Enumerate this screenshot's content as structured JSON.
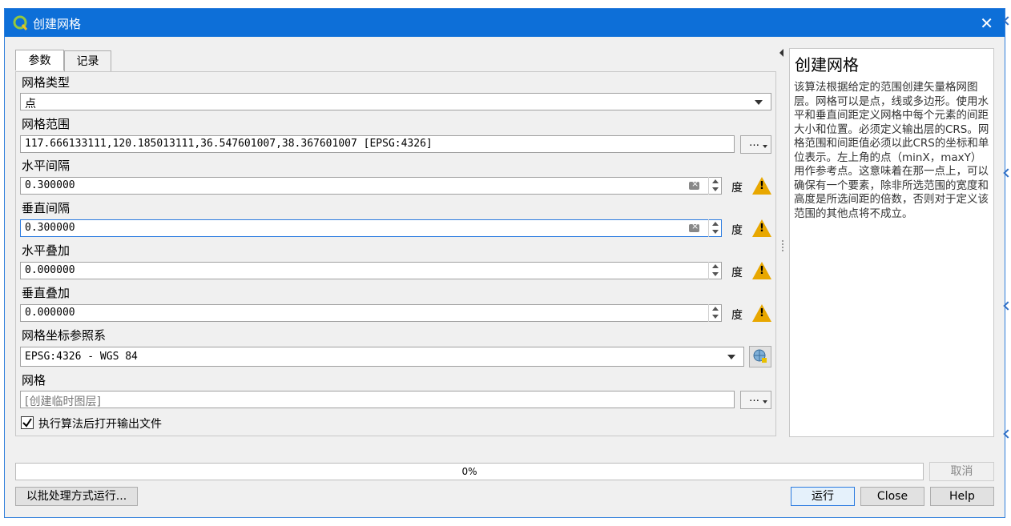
{
  "window": {
    "title": "创建网格",
    "close_glyph": "✕"
  },
  "tabs": [
    {
      "label": "参数"
    },
    {
      "label": "记录"
    }
  ],
  "params": {
    "grid_type": {
      "label": "网格类型",
      "value": "点"
    },
    "grid_extent": {
      "label": "网格范围",
      "value": "117.666133111,120.185013111,36.547601007,38.367601007 [EPSG:4326]",
      "button": "…"
    },
    "h_spacing": {
      "label": "水平间隔",
      "value": "0.300000",
      "unit": "度"
    },
    "v_spacing": {
      "label": "垂直间隔",
      "value": "0.300000",
      "unit": "度"
    },
    "h_overlay": {
      "label": "水平叠加",
      "value": "0.000000",
      "unit": "度"
    },
    "v_overlay": {
      "label": "垂直叠加",
      "value": "0.000000",
      "unit": "度"
    },
    "grid_crs": {
      "label": "网格坐标参照系",
      "value": "EPSG:4326 - WGS 84"
    },
    "output": {
      "label": "网格",
      "placeholder": "[创建临时图层]",
      "button": "…"
    },
    "open_output": {
      "label": "执行算法后打开输出文件",
      "checked": true
    }
  },
  "help": {
    "title": "创建网格",
    "body": "该算法根据给定的范围创建矢量格网图层。网格可以是点，线或多边形。使用水平和垂直间距定义网格中每个元素的间距大小和位置。必须定义输出层的CRS。网格范围和间距值必须以此CRS的坐标和单位表示。左上角的点（minX，maxY）用作参考点。这意味着在那一点上，可以确保有一个要素，除非所选范围的宽度和高度是所选间距的倍数，否则对于定义该范围的其他点将不成立。"
  },
  "progress": {
    "text": "0%",
    "value": 0
  },
  "buttons": {
    "cancel": "取消",
    "batch": "以批处理方式运行...",
    "run": "运行",
    "close": "Close",
    "help": "Help"
  },
  "colors": {
    "titlebar": "#0d6fd8",
    "warning": "#e8a700",
    "focus": "#2b7be0"
  }
}
